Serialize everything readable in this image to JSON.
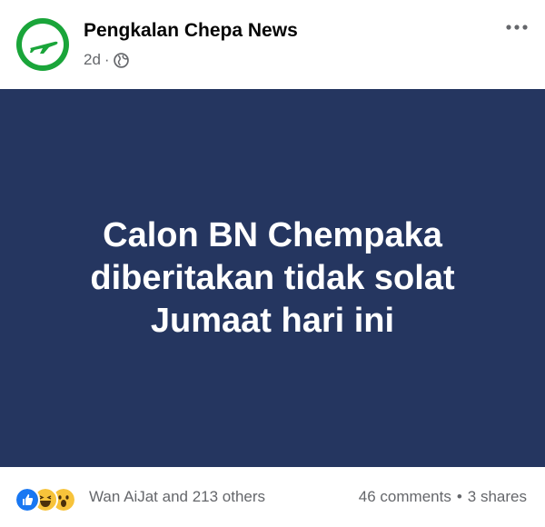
{
  "post": {
    "page_name": "Pengkalan Chepa News",
    "time": "2d",
    "separator": "·",
    "audience_icon": "globe-icon",
    "banner_text": "Calon BN Chempaka diberitakan tidak solat Jumaat hari ini",
    "banner_color": "#253660"
  },
  "footer": {
    "reactions": [
      "like-icon",
      "haha-icon",
      "wow-icon"
    ],
    "reaction_summary": "Wan AiJat and 213 others",
    "comments": "46 comments",
    "dot": "•",
    "shares": "3 shares"
  },
  "colors": {
    "accent": "#1877f2",
    "avatar_ring": "#1aa53a"
  }
}
